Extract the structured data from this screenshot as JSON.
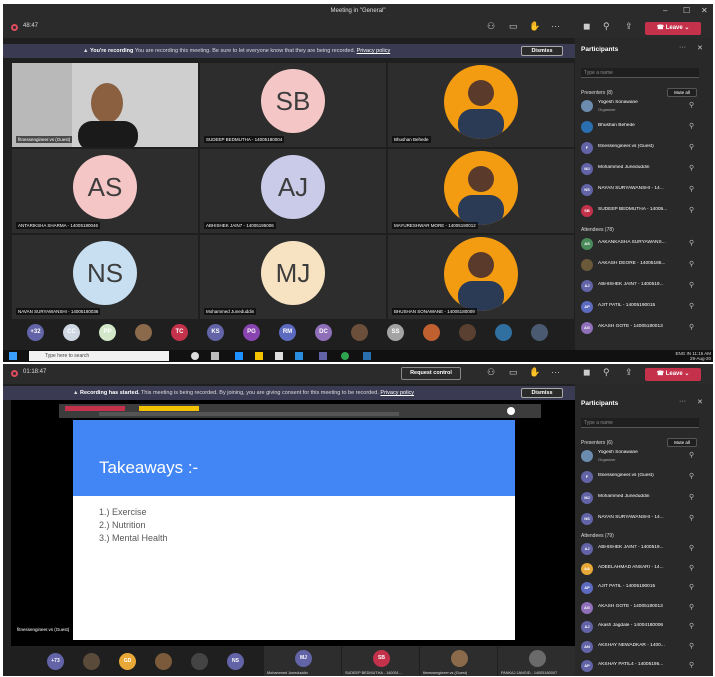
{
  "top": {
    "title": "Meeting in \"General\"",
    "timer": "48:47",
    "leave_label": "Leave",
    "banner_title": "You're recording",
    "banner_text": "You are recording this meeting. Be sure to let everyone know that they are being recorded.",
    "banner_link": "Privacy policy",
    "dismiss_label": "Dismiss",
    "tiles": [
      {
        "name": "fitnessengineer.vs (Guest)",
        "kind": "video"
      },
      {
        "initials": "SB",
        "name": "SUDEEP BEDMUTHA - 14005180004",
        "color": "#f4c6c6"
      },
      {
        "name": "Bhushan Behede",
        "kind": "photo"
      },
      {
        "initials": "AS",
        "name": "ANTARIKSHA SHARMA - 14005180046",
        "color": "#f4c6c6"
      },
      {
        "initials": "AJ",
        "name": "ABHISHEK JAIN7 - 14005195006",
        "color": "#c9cbe8"
      },
      {
        "name": "MAYURESHWAR MORE - 14005190012",
        "kind": "photo"
      },
      {
        "initials": "NS",
        "name": "NAVAN SURYAWANSHI - 14005180036",
        "color": "#c7dff0"
      },
      {
        "initials": "MJ",
        "name": "Mohammed Juneduddin",
        "color": "#f7e3c1"
      },
      {
        "name": "BHUSHAN SONAWANE - 14005180009",
        "kind": "photo"
      }
    ],
    "dock": [
      {
        "label": "+32",
        "color": "#6264a7"
      },
      {
        "label": "CC",
        "color": "#cfd7e3"
      },
      {
        "label": "PP",
        "color": "#d3e8c8"
      },
      {
        "label": "",
        "color": "#8a6a4a"
      },
      {
        "label": "TC",
        "color": "#c4314b"
      },
      {
        "label": "KS",
        "color": "#6264a7"
      },
      {
        "label": "PG",
        "color": "#8a44b0"
      },
      {
        "label": "RM",
        "color": "#5c6bc0"
      },
      {
        "label": "DC",
        "color": "#8e6fb8"
      },
      {
        "label": "",
        "color": "#6b4f3a"
      },
      {
        "label": "SS",
        "color": "#a3a3a3"
      },
      {
        "label": "",
        "color": "#c06030"
      },
      {
        "label": "",
        "color": "#5a4030"
      },
      {
        "label": "",
        "color": "#3070a0"
      },
      {
        "label": "",
        "color": "#4a5a70"
      }
    ],
    "taskbar_search": "Type here to search",
    "tray_time": "11:15 AM",
    "tray_date": "29-Aug-20",
    "tray_lang": "ENG IN",
    "participants": {
      "title": "Participants",
      "search_placeholder": "Type a name",
      "presenters_header": "Presenters (8)",
      "mute_all": "Mute all",
      "presenters": [
        {
          "name": "Yogesh Sonawane",
          "sub": "Organizer",
          "initials": "",
          "color": "#6b8cae"
        },
        {
          "name": "Bhushan Behede",
          "initials": "",
          "color": "#2a6fb0"
        },
        {
          "name": "fitnessengineer.vs (Guest)",
          "initials": "F",
          "color": "#6264a7"
        },
        {
          "name": "Mohammed Juneduddin",
          "initials": "MJ",
          "color": "#6264a7"
        },
        {
          "name": "NAYAN SURYAWANSHI - 14...",
          "initials": "NS",
          "color": "#6264a7"
        },
        {
          "name": "SUDEEP BEDMUTHA - 14005...",
          "initials": "SB",
          "color": "#c4314b"
        }
      ],
      "attendees_header": "Attendees (78)",
      "attendees": [
        {
          "name": "AAKANKASHA SURYAWANS...",
          "initials": "AS",
          "color": "#4a8a5a"
        },
        {
          "name": "AAKASH DEORE - 14005185...",
          "initials": "",
          "color": "#6a5a3a"
        },
        {
          "name": "ABHISHEK JAIN7 - 1400519...",
          "initials": "AJ",
          "color": "#6264a7"
        },
        {
          "name": "AJIT PATIL - 14005190015",
          "initials": "AP",
          "color": "#5c6bc0"
        },
        {
          "name": "AKASH GOTE - 14005180013",
          "initials": "AG",
          "color": "#8e6fb8"
        }
      ]
    }
  },
  "bottom": {
    "timer": "01:18:47",
    "request_control": "Request control",
    "leave_label": "Leave",
    "banner_title": "Recording has started.",
    "banner_text": "This meeting is being recorded. By joining, you are giving consent for this meeting to be recorded.",
    "banner_link": "Privacy policy",
    "dismiss_label": "Dismiss",
    "slide_title": "Takeaways :-",
    "slide_items": [
      "1.)   Exercise",
      "2.)   Nutrition",
      "3.)   Mental Health"
    ],
    "sharer": "fitnessengineer.vs (Guest)",
    "dock": [
      {
        "label": "+73",
        "color": "#6264a7"
      },
      {
        "label": "",
        "color": "#5a4a3a"
      },
      {
        "label": "GD",
        "color": "#e8a838"
      },
      {
        "label": "",
        "color": "#7a5a3a"
      },
      {
        "label": "",
        "color": "#444"
      },
      {
        "label": "NS",
        "color": "#6264a7"
      }
    ],
    "dock_tiles": [
      {
        "initials": "MJ",
        "name": "Mohammed Juneduddin",
        "color": "#6264a7"
      },
      {
        "initials": "SB",
        "name": "SUDEEP BEDMUTHA - 140051...",
        "color": "#c4314b"
      },
      {
        "initials": "",
        "name": "fitnessengineer.vs (Guest)",
        "color": "#8a6a4a"
      },
      {
        "initials": "",
        "name": "PANKAJ JANGID - 14005180007",
        "color": "#6a6a6a"
      }
    ],
    "participants": {
      "title": "Participants",
      "search_placeholder": "Type a name",
      "presenters_header": "Presenters (6)",
      "mute_all": "Mute all",
      "presenters": [
        {
          "name": "Yogesh Sonawane",
          "sub": "Organizer",
          "initials": "",
          "color": "#6b8cae"
        },
        {
          "name": "fitnessengineer.vs (Guest)",
          "initials": "F",
          "color": "#6264a7"
        },
        {
          "name": "Mohammed Juneduddin",
          "initials": "MJ",
          "color": "#6264a7"
        },
        {
          "name": "NAYAN SURYAWANSHI - 14...",
          "initials": "NS",
          "color": "#6264a7"
        }
      ],
      "attendees_header": "Attendees (79)",
      "attendees": [
        {
          "name": "ABHISHEK JAIN7 - 1400519...",
          "initials": "AJ",
          "color": "#6264a7"
        },
        {
          "name": "ADEELAHMAD ANSARI - 14...",
          "initials": "AA",
          "color": "#e8a838"
        },
        {
          "name": "AJIT PATIL - 14005190015",
          "initials": "AP",
          "color": "#5c6bc0"
        },
        {
          "name": "AKASH GOTE - 14005180013",
          "initials": "AG",
          "color": "#8e6fb8"
        },
        {
          "name": "Akash Jagdale - 14004180006",
          "initials": "AJ",
          "color": "#6264a7"
        },
        {
          "name": "AKSHAY NEWADKAR - 1400...",
          "initials": "AN",
          "color": "#6264a7"
        },
        {
          "name": "AKSHAY PATIL4 - 14005195...",
          "initials": "AP",
          "color": "#6264a7"
        }
      ]
    }
  }
}
